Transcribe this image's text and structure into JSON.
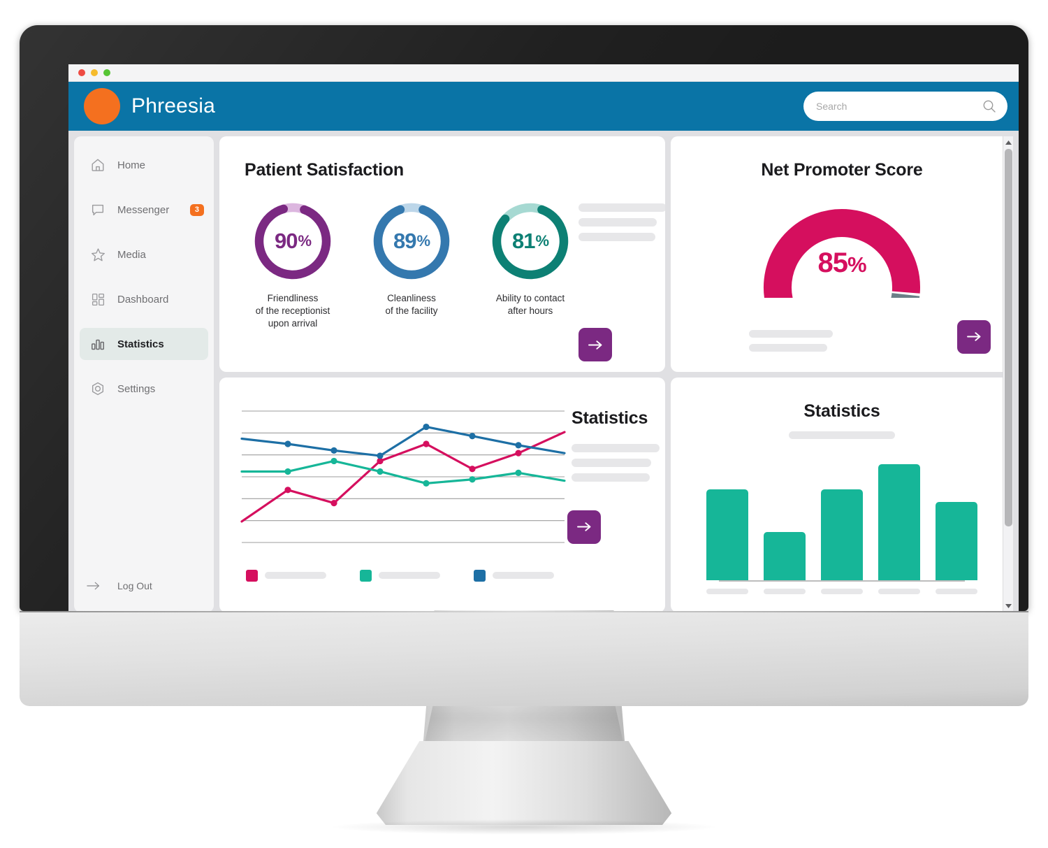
{
  "window": {
    "traffic_lights": [
      "close",
      "minimize",
      "maximize"
    ]
  },
  "header": {
    "brand_name": "Phreesia",
    "logo": "orange-circle-logo",
    "search": {
      "placeholder": "Search",
      "value": "",
      "icon": "search-icon"
    }
  },
  "sidebar": {
    "items": [
      {
        "label": "Home",
        "icon": "home-icon",
        "active": false,
        "badge": ""
      },
      {
        "label": "Messenger",
        "icon": "chat-icon",
        "active": false,
        "badge": "3"
      },
      {
        "label": "Media",
        "icon": "star-icon",
        "active": false,
        "badge": ""
      },
      {
        "label": "Dashboard",
        "icon": "grid-icon",
        "active": false,
        "badge": ""
      },
      {
        "label": "Statistics",
        "icon": "bar-chart-icon",
        "active": true,
        "badge": ""
      },
      {
        "label": "Settings",
        "icon": "hexagon-icon",
        "active": false,
        "badge": ""
      }
    ],
    "logout": {
      "label": "Log Out",
      "icon": "arrow-right-icon"
    }
  },
  "cards": {
    "patient_satisfaction": {
      "title": "Patient Satisfaction",
      "cta_icon": "arrow-right-icon",
      "placeholder_lines": 3
    },
    "net_promoter_score": {
      "title": "Net Promoter Score",
      "cta_icon": "arrow-right-icon",
      "placeholder_lines": 2
    },
    "statistics_lines": {
      "title": "Statistics",
      "cta_icon": "arrow-right-icon",
      "placeholder_lines": 3
    },
    "statistics_bars": {
      "title": "Statistics"
    }
  },
  "colors": {
    "header_blue": "#0a74a6",
    "logo_orange": "#f4701f",
    "badge_orange": "#f4701f",
    "purple": "#7b2982",
    "purple_light": "#dcb6df",
    "blue": "#3478ae",
    "blue_light": "#bcd6e9",
    "teal": "#0d8074",
    "teal_light": "#a6d9d2",
    "crimson": "#d50f5e",
    "gray_gauge": "#6b7f87",
    "green_bar": "#16b698",
    "line_pink": "#d50f5e",
    "line_teal": "#16b698",
    "line_blue": "#1d6fa5",
    "active_nav_bg": "#e3eae8"
  },
  "chart_data": [
    {
      "type": "pie",
      "name": "patient-satisfaction-donuts",
      "title": "Patient Satisfaction",
      "donuts": [
        {
          "value": 90,
          "value_label": "90",
          "unit": "%",
          "caption": "Friendliness\nof the receptionist\nupon arrival",
          "color": "#7b2982",
          "track": "#dcb6df"
        },
        {
          "value": 89,
          "value_label": "89",
          "unit": "%",
          "caption": "Cleanliness\nof the facility",
          "color": "#3478ae",
          "track": "#bcd6e9"
        },
        {
          "value": 81,
          "value_label": "81",
          "unit": "%",
          "caption": "Ability to contact\nafter hours",
          "color": "#0d8074",
          "track": "#a6d9d2"
        }
      ]
    },
    {
      "type": "pie",
      "name": "net-promoter-score-gauge",
      "title": "Net Promoter Score",
      "value": 85,
      "value_label": "85",
      "unit": "%",
      "arc_span_degrees": 270,
      "filled_color": "#d50f5e",
      "remainder_color": "#6b7f87"
    },
    {
      "type": "line",
      "name": "statistics-line-chart",
      "title": "Statistics",
      "grid": true,
      "gridlines": 7,
      "legend_position": "bottom",
      "x": [
        1,
        2,
        3,
        4,
        5,
        6,
        7,
        8
      ],
      "ylim": [
        0,
        100
      ],
      "series": [
        {
          "name": "series-1",
          "color": "#d50f5e",
          "values": [
            16,
            40,
            30,
            62,
            75,
            56,
            68,
            84
          ]
        },
        {
          "name": "series-2",
          "color": "#16b698",
          "values": [
            54,
            54,
            62,
            54,
            45,
            48,
            53,
            47
          ]
        },
        {
          "name": "series-3",
          "color": "#1d6fa5",
          "values": [
            79,
            75,
            70,
            66,
            88,
            81,
            74,
            68
          ]
        }
      ]
    },
    {
      "type": "bar",
      "name": "statistics-bar-chart",
      "title": "Statistics",
      "categories": [
        "",
        "",
        "",
        "",
        ""
      ],
      "values": [
        72,
        38,
        72,
        92,
        62
      ],
      "ylim": [
        0,
        100
      ],
      "color": "#16b698",
      "grid": false
    }
  ]
}
